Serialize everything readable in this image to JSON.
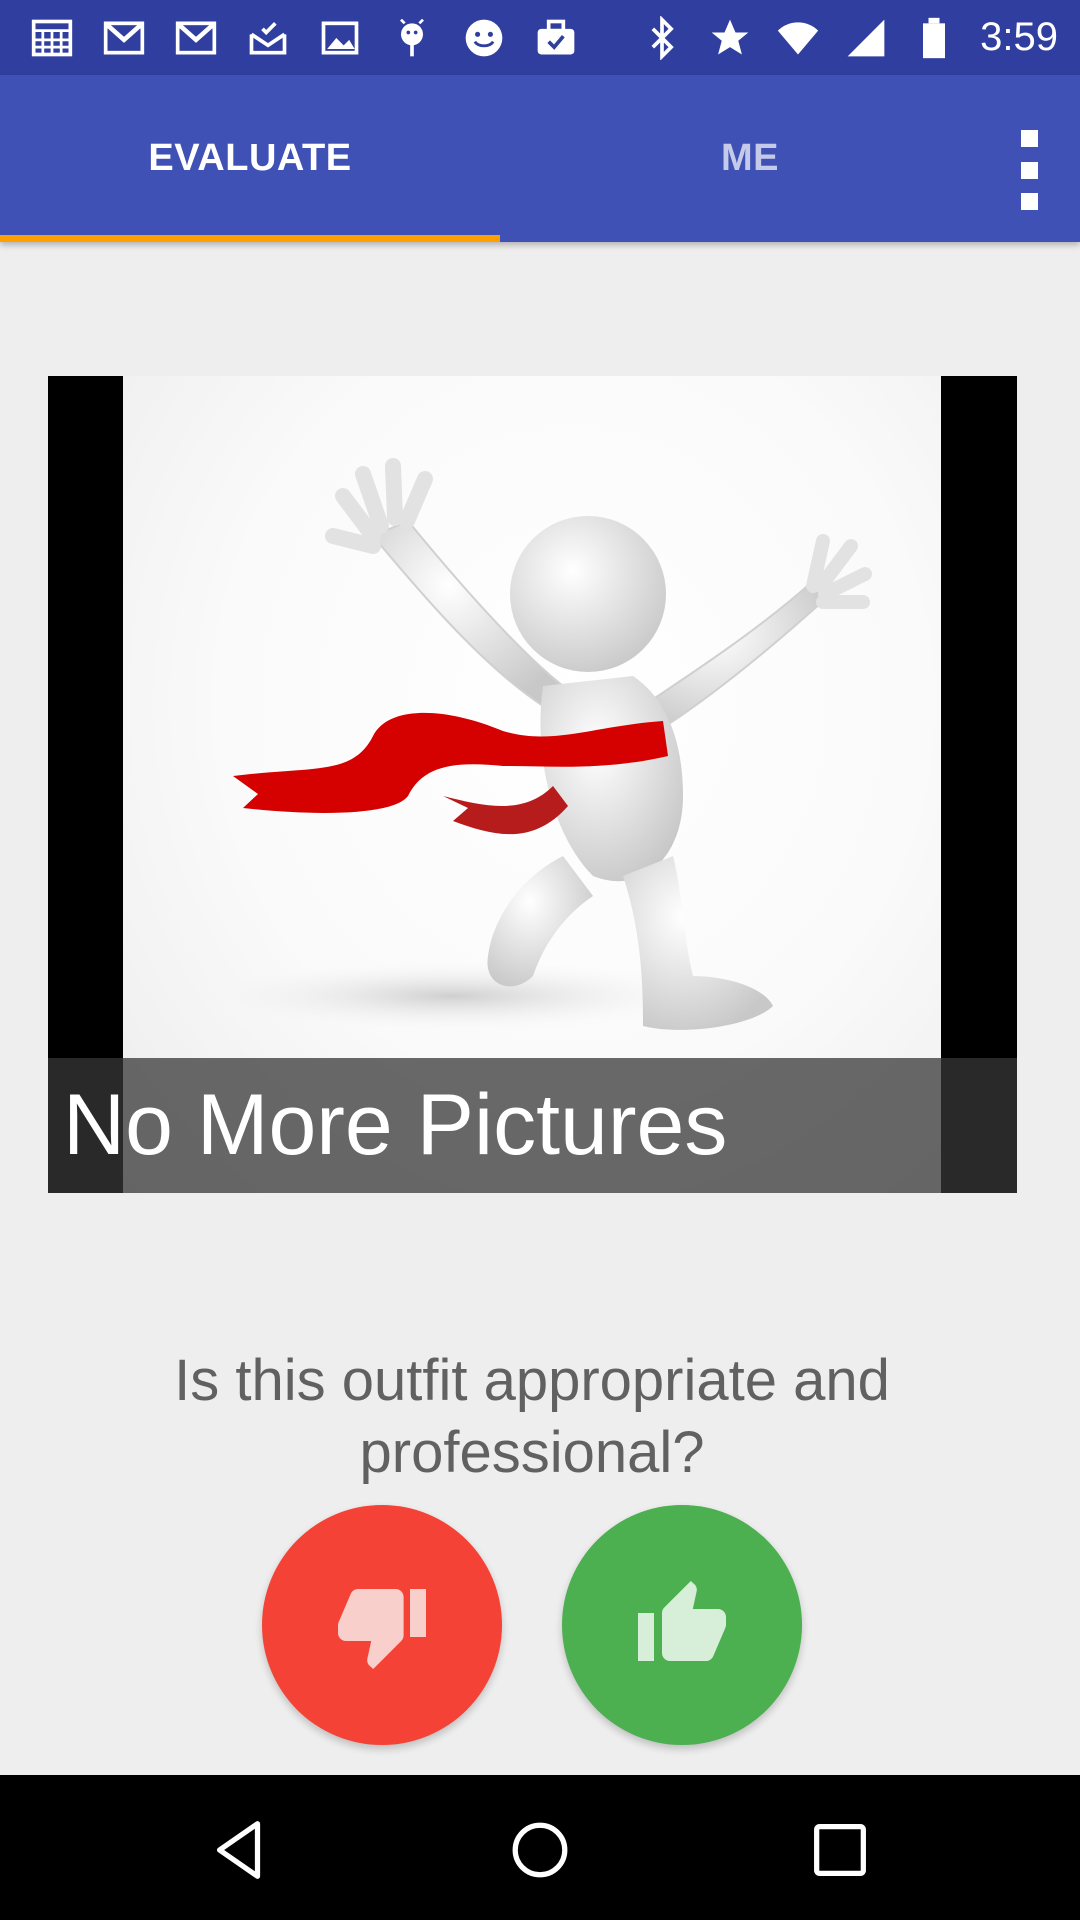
{
  "status_bar": {
    "time": "3:59",
    "left_icons": [
      "calendar-icon",
      "gmail-icon",
      "gmail-icon",
      "inbox-icon",
      "image-icon",
      "android-debug-icon",
      "smiley-icon",
      "briefcase-check-icon"
    ],
    "right_icons": [
      "bluetooth-icon",
      "star-icon",
      "wifi-icon",
      "signal-icon",
      "battery-icon"
    ],
    "color": "#303f9f"
  },
  "app_bar": {
    "color": "#3f51b5",
    "indicator_color": "#ffa000",
    "tabs": [
      {
        "label": "EVALUATE",
        "selected": true
      },
      {
        "label": "ME",
        "selected": false
      }
    ],
    "overflow_icon": "more-vert-icon"
  },
  "photo": {
    "description_icon": "finish-line-figure-image",
    "caption": "No More Pictures"
  },
  "question": {
    "text": "Is this outfit appropriate and professional?"
  },
  "vote": {
    "down": {
      "icon": "thumbs-down-icon",
      "color": "#f44336"
    },
    "up": {
      "icon": "thumbs-up-icon",
      "color": "#4caf50"
    }
  },
  "nav_bar": {
    "buttons": [
      "back-icon",
      "home-icon",
      "recents-icon"
    ]
  }
}
